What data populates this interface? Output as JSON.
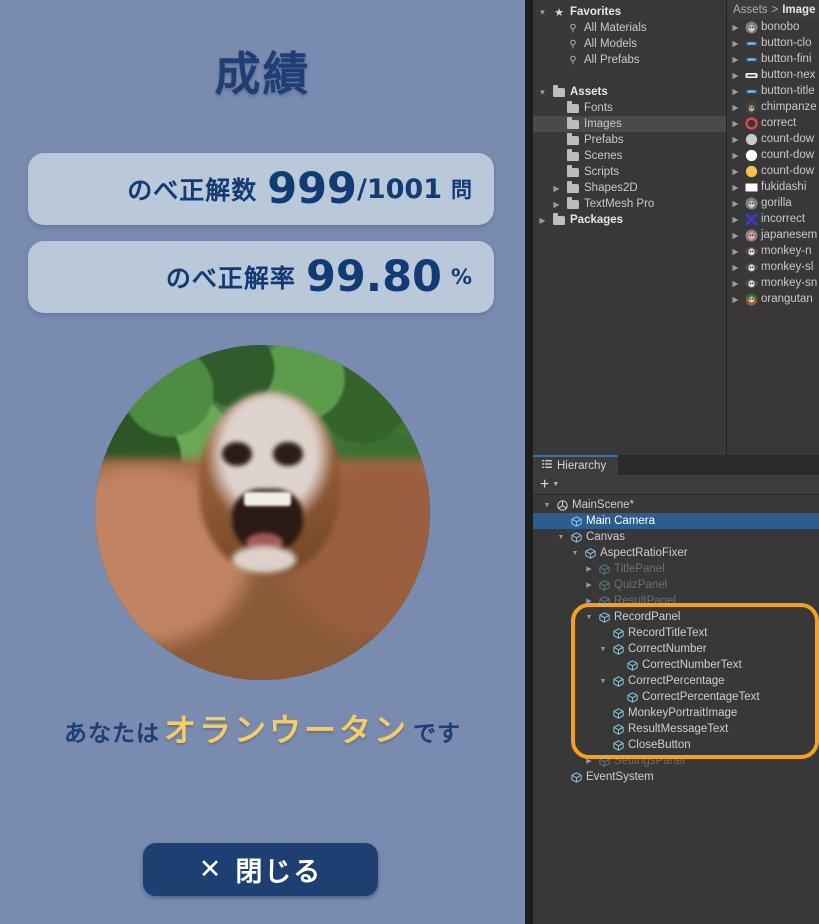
{
  "game": {
    "background_color": "#7a8bb0",
    "title": "成績",
    "title_color": "#1e3f73",
    "card_bg": "#b9c9da",
    "card_text_color": "#123b74",
    "correct_number": {
      "label": "のべ正解数",
      "value": "999",
      "separator": "/",
      "total": "1001",
      "unit": "問"
    },
    "correct_percentage": {
      "label": "のべ正解率",
      "value": "99.80",
      "unit": "%"
    },
    "portrait": "orangutan-portrait",
    "result_message": {
      "prefix": "あなたは",
      "highlight": "オランウータン",
      "suffix": "です",
      "highlight_color": "#f5cd63"
    },
    "close_button": {
      "icon": "✕",
      "label": "閉じる",
      "bg": "#1d3f72",
      "fg": "#ffffff"
    }
  },
  "editor": {
    "project": {
      "tree": [
        {
          "label": "Favorites",
          "icon": "star-icon",
          "depth": 0,
          "twisty": "open",
          "bold": true,
          "selected": false
        },
        {
          "label": "All Materials",
          "icon": "search-icon",
          "depth": 1,
          "twisty": "none",
          "bold": false,
          "selected": false
        },
        {
          "label": "All Models",
          "icon": "search-icon",
          "depth": 1,
          "twisty": "none",
          "bold": false,
          "selected": false
        },
        {
          "label": "All Prefabs",
          "icon": "search-icon",
          "depth": 1,
          "twisty": "none",
          "bold": false,
          "selected": false
        },
        {
          "label": "",
          "icon": "none",
          "depth": 0,
          "twisty": "none",
          "bold": false,
          "selected": false
        },
        {
          "label": "Assets",
          "icon": "folder-open-icon",
          "depth": 0,
          "twisty": "open",
          "bold": true,
          "selected": false
        },
        {
          "label": "Fonts",
          "icon": "folder-icon",
          "depth": 1,
          "twisty": "none",
          "bold": false,
          "selected": false
        },
        {
          "label": "Images",
          "icon": "folder-icon",
          "depth": 1,
          "twisty": "none",
          "bold": false,
          "selected": true
        },
        {
          "label": "Prefabs",
          "icon": "folder-icon",
          "depth": 1,
          "twisty": "none",
          "bold": false,
          "selected": false
        },
        {
          "label": "Scenes",
          "icon": "folder-icon",
          "depth": 1,
          "twisty": "none",
          "bold": false,
          "selected": false
        },
        {
          "label": "Scripts",
          "icon": "folder-icon",
          "depth": 1,
          "twisty": "none",
          "bold": false,
          "selected": false
        },
        {
          "label": "Shapes2D",
          "icon": "folder-icon",
          "depth": 1,
          "twisty": "closed",
          "bold": false,
          "selected": false
        },
        {
          "label": "TextMesh Pro",
          "icon": "folder-icon",
          "depth": 1,
          "twisty": "closed",
          "bold": false,
          "selected": false
        },
        {
          "label": "Packages",
          "icon": "folder-icon",
          "depth": 0,
          "twisty": "closed",
          "bold": true,
          "selected": false
        }
      ],
      "breadcrumb": {
        "root": "Assets",
        "separator": ">",
        "current": "Image"
      },
      "assets": [
        {
          "label": "bonobo",
          "icon": "thumb-monkey-gray"
        },
        {
          "label": "button-clo",
          "icon": "thumb-button-blue"
        },
        {
          "label": "button-fini",
          "icon": "thumb-button-blue"
        },
        {
          "label": "button-nex",
          "icon": "thumb-button-white"
        },
        {
          "label": "button-title",
          "icon": "thumb-button-blue"
        },
        {
          "label": "chimpanze",
          "icon": "thumb-monkey-dark"
        },
        {
          "label": "correct",
          "icon": "thumb-circle-red"
        },
        {
          "label": "count-dow",
          "icon": "thumb-circle-gray"
        },
        {
          "label": "count-dow",
          "icon": "thumb-circle-white"
        },
        {
          "label": "count-dow",
          "icon": "thumb-circle-yellow"
        },
        {
          "label": "fukidashi",
          "icon": "thumb-square-white"
        },
        {
          "label": "gorilla",
          "icon": "thumb-monkey-gray"
        },
        {
          "label": "incorrect",
          "icon": "thumb-cross-blue"
        },
        {
          "label": "japanesem",
          "icon": "thumb-monkey-pink"
        },
        {
          "label": "monkey-n",
          "icon": "thumb-monkey-face"
        },
        {
          "label": "monkey-sl",
          "icon": "thumb-monkey-face"
        },
        {
          "label": "monkey-sn",
          "icon": "thumb-monkey-face"
        },
        {
          "label": "orangutan",
          "icon": "thumb-monkey-orange"
        }
      ]
    },
    "hierarchy": {
      "tab_label": "Hierarchy",
      "add_button": "+",
      "highlight_color": "#f5a01e",
      "items": [
        {
          "label": "MainScene*",
          "depth": 0,
          "twisty": "open",
          "icon": "scene-icon",
          "selected": false,
          "dim": false
        },
        {
          "label": "Main Camera",
          "depth": 1,
          "twisty": "none",
          "icon": "gameobject-icon",
          "selected": true,
          "dim": false
        },
        {
          "label": "Canvas",
          "depth": 1,
          "twisty": "open",
          "icon": "gameobject-icon",
          "selected": false,
          "dim": false
        },
        {
          "label": "AspectRatioFixer",
          "depth": 2,
          "twisty": "open",
          "icon": "gameobject-icon",
          "selected": false,
          "dim": false
        },
        {
          "label": "TitlePanel",
          "depth": 3,
          "twisty": "closed",
          "icon": "gameobject-icon",
          "selected": false,
          "dim": true
        },
        {
          "label": "QuizPanel",
          "depth": 3,
          "twisty": "closed",
          "icon": "gameobject-icon",
          "selected": false,
          "dim": true
        },
        {
          "label": "ResultPanel",
          "depth": 3,
          "twisty": "closed",
          "icon": "gameobject-icon",
          "selected": false,
          "dim": true
        },
        {
          "label": "RecordPanel",
          "depth": 3,
          "twisty": "open",
          "icon": "gameobject-icon",
          "selected": false,
          "dim": false
        },
        {
          "label": "RecordTitleText",
          "depth": 4,
          "twisty": "none",
          "icon": "gameobject-icon",
          "selected": false,
          "dim": false
        },
        {
          "label": "CorrectNumber",
          "depth": 4,
          "twisty": "open",
          "icon": "gameobject-icon",
          "selected": false,
          "dim": false
        },
        {
          "label": "CorrectNumberText",
          "depth": 5,
          "twisty": "none",
          "icon": "gameobject-icon",
          "selected": false,
          "dim": false
        },
        {
          "label": "CorrectPercentage",
          "depth": 4,
          "twisty": "open",
          "icon": "gameobject-icon",
          "selected": false,
          "dim": false
        },
        {
          "label": "CorrectPercentageText",
          "depth": 5,
          "twisty": "none",
          "icon": "gameobject-icon",
          "selected": false,
          "dim": false
        },
        {
          "label": "MonkeyPortraitImage",
          "depth": 4,
          "twisty": "none",
          "icon": "gameobject-icon",
          "selected": false,
          "dim": false
        },
        {
          "label": "ResultMessageText",
          "depth": 4,
          "twisty": "none",
          "icon": "gameobject-icon",
          "selected": false,
          "dim": false
        },
        {
          "label": "CloseButton",
          "depth": 4,
          "twisty": "none",
          "icon": "gameobject-icon",
          "selected": false,
          "dim": false
        },
        {
          "label": "SettingsPanel",
          "depth": 3,
          "twisty": "closed",
          "icon": "gameobject-icon",
          "selected": false,
          "dim": true
        },
        {
          "label": "EventSystem",
          "depth": 1,
          "twisty": "none",
          "icon": "gameobject-icon",
          "selected": false,
          "dim": false
        }
      ]
    }
  }
}
